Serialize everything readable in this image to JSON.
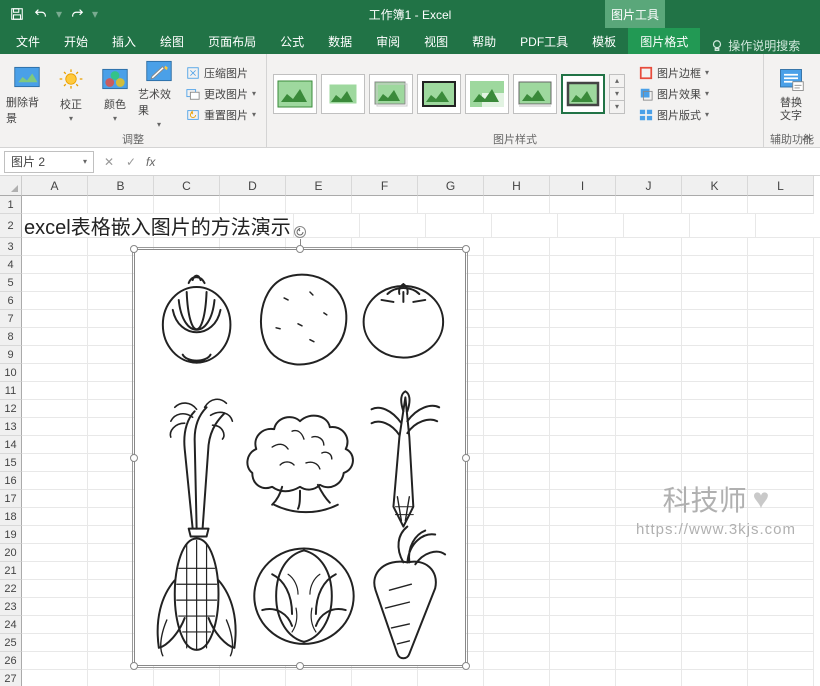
{
  "title": "工作簿1 - Excel",
  "context_tab": "图片工具",
  "tabs": {
    "file": "文件",
    "home": "开始",
    "insert": "插入",
    "draw": "绘图",
    "layout": "页面布局",
    "formulas": "公式",
    "data": "数据",
    "review": "审阅",
    "view": "视图",
    "help": "帮助",
    "pdf": "PDF工具",
    "template": "模板",
    "pic_format": "图片格式",
    "tell_me": "操作说明搜索"
  },
  "ribbon": {
    "remove_bg": "删除背景",
    "corrections": "校正",
    "color": "颜色",
    "artistic": "艺术效果",
    "compress": "压缩图片",
    "change_pic": "更改图片",
    "reset_pic": "重置图片",
    "adjust_group": "调整",
    "styles_group": "图片样式",
    "border": "图片边框",
    "effects": "图片效果",
    "layout_pic": "图片版式",
    "alt_text": "替换\n文字",
    "accessibility_group": "辅助功能"
  },
  "name_box": "图片 2",
  "columns": [
    "A",
    "B",
    "C",
    "D",
    "E",
    "F",
    "G",
    "H",
    "I",
    "J",
    "K",
    "L"
  ],
  "rows": [
    "1",
    "2",
    "3",
    "4",
    "5",
    "6",
    "7",
    "8",
    "9",
    "10",
    "11",
    "12",
    "13",
    "14",
    "15",
    "16",
    "17",
    "18",
    "19",
    "20",
    "21",
    "22",
    "23",
    "24",
    "25",
    "26",
    "27"
  ],
  "cell_a2": "excel表格嵌入图片的方法演示",
  "watermark": {
    "name": "科技师",
    "url": "https://www.3kjs.com"
  },
  "image_name": "vegetables-lineart"
}
